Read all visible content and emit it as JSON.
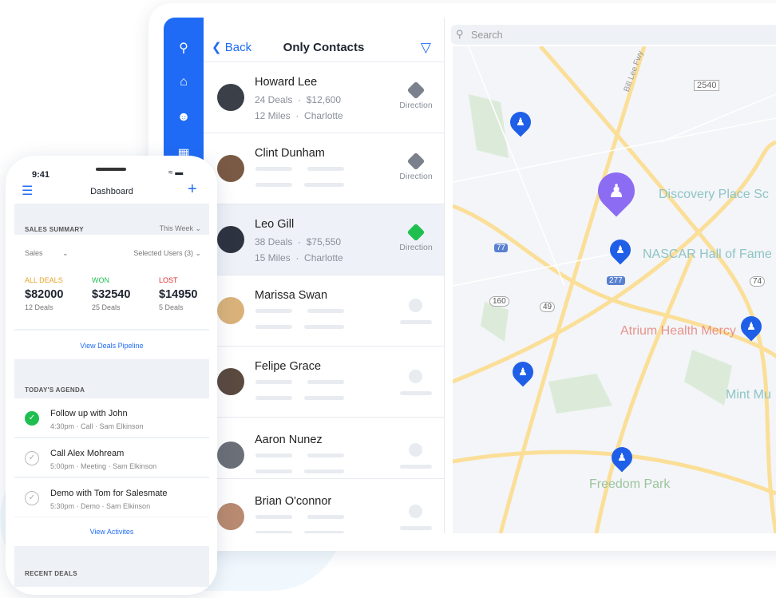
{
  "tablet": {
    "sidebar": {
      "icons": [
        "search-icon",
        "home-icon",
        "user-icon",
        "calendar-icon"
      ]
    },
    "list": {
      "back_label": "Back",
      "title": "Only Contacts",
      "filter_icon": "filter-icon",
      "contacts": [
        {
          "name": "Howard Lee",
          "deals": "24 Deals",
          "amount": "$12,600",
          "distance": "12 Miles",
          "city": "Charlotte",
          "action": "Direction",
          "active": false,
          "selected": false,
          "avatar": "#3a3f48"
        },
        {
          "name": "Clint Dunham",
          "action": "Direction",
          "active": false,
          "selected": false,
          "avatar": "#7a5a44"
        },
        {
          "name": "Leo Gill",
          "deals": "38 Deals",
          "amount": "$75,550",
          "distance": "15 Miles",
          "city": "Charlotte",
          "action": "Direction",
          "active": true,
          "selected": true,
          "avatar": "#2e3340"
        },
        {
          "name": "Marissa Swan",
          "selected": false,
          "avatar": "#d9b27a"
        },
        {
          "name": "Felipe Grace",
          "selected": false,
          "avatar": "#5a4a40"
        },
        {
          "name": "Aaron Nunez",
          "selected": false,
          "avatar": "#6b6f78"
        },
        {
          "name": "Brian O'connor",
          "selected": false,
          "avatar": "#b88a70"
        }
      ]
    },
    "map": {
      "search_placeholder": "Search",
      "labels": {
        "discovery": "Discovery Place Sc",
        "nascar": "NASCAR Hall of Fame",
        "atrium": "Atrium Health Mercy",
        "mint": "Mint Mu",
        "freedom": "Freedom Park",
        "road": "Bill Lee Fwy",
        "r2540": "2540",
        "r77": "77",
        "r277": "277",
        "r160": "160",
        "r49": "49",
        "r74": "74"
      },
      "colors": {
        "pin": "#1f5fe8",
        "active_pin": "#8b6cf2",
        "road": "#fbdf98",
        "park": "#dcebd9"
      }
    }
  },
  "phone": {
    "time": "9:41",
    "title": "Dashboard",
    "sales": {
      "caption": "SALES SUMMARY",
      "period": "This Week",
      "filter1": "Sales",
      "filter2": "Selected Users (3)",
      "stats": [
        {
          "label": "ALL DEALS",
          "value": "$82000",
          "deals": "12 Deals",
          "color": "#e8a32a"
        },
        {
          "label": "WON",
          "value": "$32540",
          "deals": "25 Deals",
          "color": "#1fbf4f"
        },
        {
          "label": "LOST",
          "value": "$14950",
          "deals": "5 Deals",
          "color": "#e02b2b"
        }
      ],
      "link": "View Deals Pipeline"
    },
    "agenda": {
      "caption": "TODAY'S AGENDA",
      "items": [
        {
          "title": "Follow up with John",
          "time": "4:30pm",
          "type": "Call",
          "owner": "Sam Elkinson",
          "done": true
        },
        {
          "title": "Call Alex Mohream",
          "time": "5:00pm",
          "type": "Meeting",
          "owner": "Sam Elkinson",
          "done": false
        },
        {
          "title": "Demo with Tom for Salesmate",
          "time": "5:30pm",
          "type": "Demo",
          "owner": "Sam Elkinson",
          "done": false
        }
      ],
      "link": "View Activites"
    },
    "recent": {
      "caption": "RECENT DEALS"
    }
  }
}
